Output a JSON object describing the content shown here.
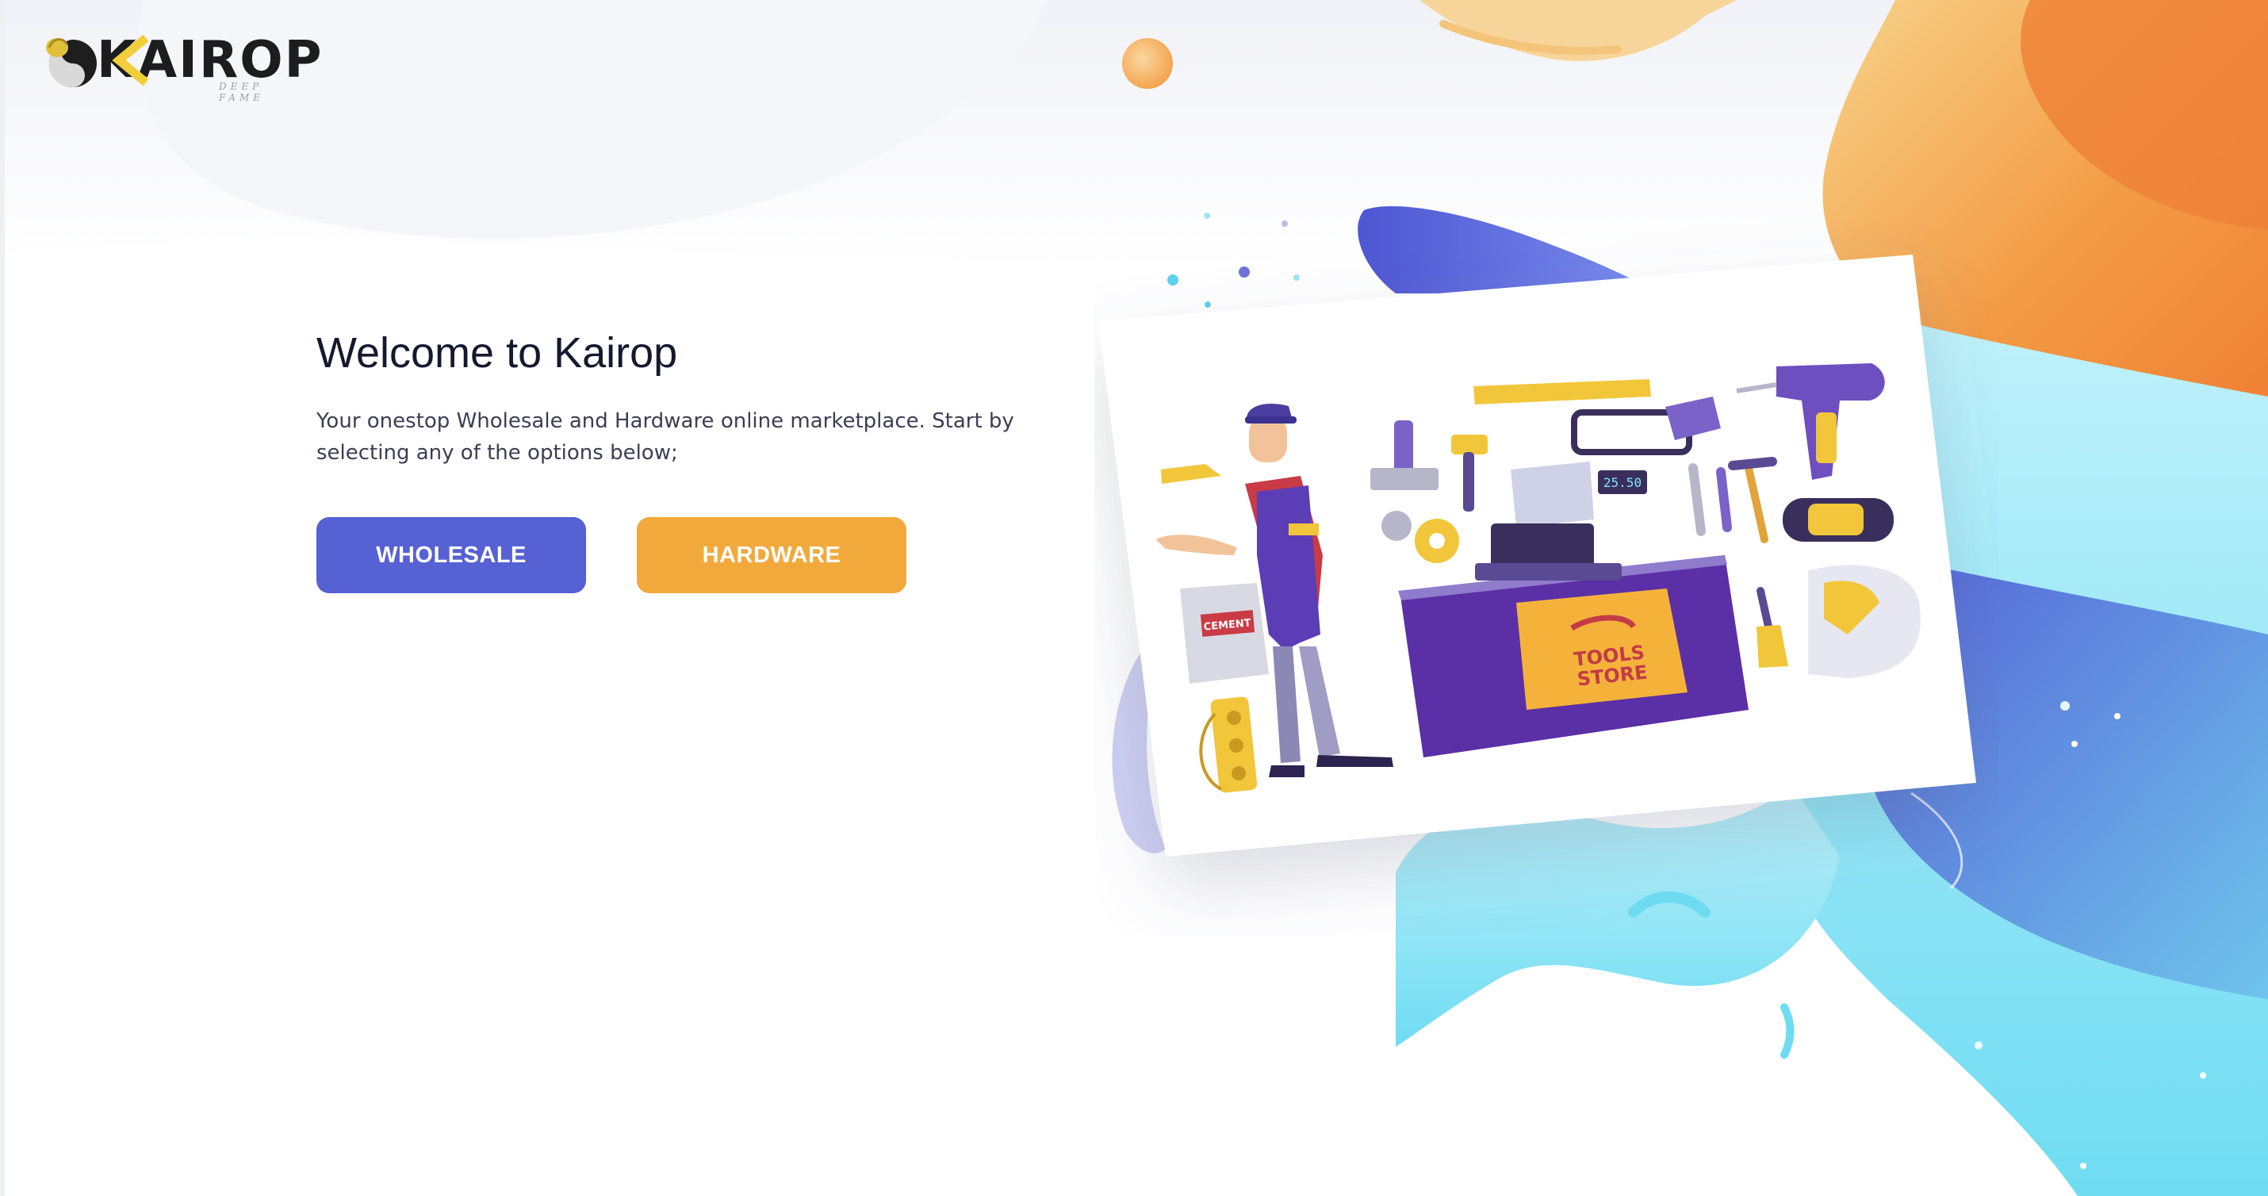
{
  "brand": {
    "name": "KAIROP",
    "tagline": "DEEP FAME",
    "logo_icon": "yin-yang-icon"
  },
  "hero": {
    "title": "Welcome to Kairop",
    "subtitle": "Your onestop Wholesale and Hardware online marketplace. Start by selecting any of the options below;"
  },
  "buttons": {
    "wholesale_label": "WHOLESALE",
    "hardware_label": "HARDWARE"
  },
  "illustration": {
    "sign_line1": "TOOLS",
    "sign_line2": "STORE",
    "register_display": "25.50",
    "bag_label": "CEMENT"
  },
  "colors": {
    "primary": "#5661d4",
    "accent": "#f2a93b",
    "heading": "#14192d",
    "text": "#3a3f52"
  }
}
